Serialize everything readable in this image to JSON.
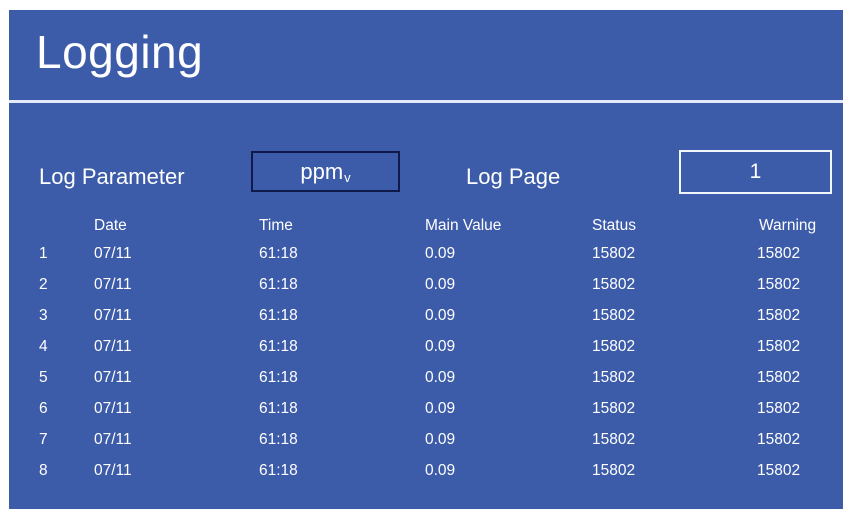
{
  "title": "Logging",
  "log_parameter": {
    "label": "Log Parameter",
    "value_main": "ppm",
    "value_sub": "v"
  },
  "log_page": {
    "label": "Log Page",
    "value": "1"
  },
  "table": {
    "columns": [
      "Date",
      "Time",
      "Main Value",
      "Status",
      "Warning"
    ],
    "rows": [
      {
        "idx": "1",
        "date": "07/11",
        "time": "61:18",
        "main": "0.09",
        "status": "15802",
        "warning": "15802"
      },
      {
        "idx": "2",
        "date": "07/11",
        "time": "61:18",
        "main": "0.09",
        "status": "15802",
        "warning": "15802"
      },
      {
        "idx": "3",
        "date": "07/11",
        "time": "61:18",
        "main": "0.09",
        "status": "15802",
        "warning": "15802"
      },
      {
        "idx": "4",
        "date": "07/11",
        "time": "61:18",
        "main": "0.09",
        "status": "15802",
        "warning": "15802"
      },
      {
        "idx": "5",
        "date": "07/11",
        "time": "61:18",
        "main": "0.09",
        "status": "15802",
        "warning": "15802"
      },
      {
        "idx": "6",
        "date": "07/11",
        "time": "61:18",
        "main": "0.09",
        "status": "15802",
        "warning": "15802"
      },
      {
        "idx": "7",
        "date": "07/11",
        "time": "61:18",
        "main": "0.09",
        "status": "15802",
        "warning": "15802"
      },
      {
        "idx": "8",
        "date": "07/11",
        "time": "61:18",
        "main": "0.09",
        "status": "15802",
        "warning": "15802"
      }
    ]
  },
  "colors": {
    "background": "#3c5ba9",
    "text": "#ffffff",
    "parameter_box_border": "#101a4a",
    "page_box_border": "#f2f5fc"
  }
}
